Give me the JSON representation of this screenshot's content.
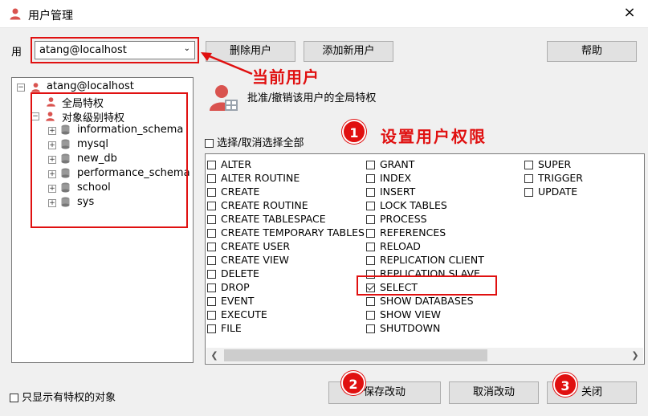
{
  "window": {
    "title": "用户管理",
    "close_label": "×"
  },
  "user_row": {
    "label": "用",
    "current_user": "atang@localhost",
    "delete_label": "删除用户",
    "add_label": "添加新用户",
    "help_label": "帮助"
  },
  "tree": {
    "root": "atang@localhost",
    "global": "全局特权",
    "object": "对象级别特权",
    "databases": [
      "information_schema",
      "mysql",
      "new_db",
      "performance_schema",
      "school",
      "sys"
    ]
  },
  "privileges_header": {
    "description": "批准/撤销该用户的全局特权",
    "select_all": "选择/取消选择全部"
  },
  "privileges": {
    "col1": [
      {
        "label": "ALTER",
        "checked": false
      },
      {
        "label": "ALTER ROUTINE",
        "checked": false
      },
      {
        "label": "CREATE",
        "checked": false
      },
      {
        "label": "CREATE ROUTINE",
        "checked": false
      },
      {
        "label": "CREATE TABLESPACE",
        "checked": false
      },
      {
        "label": "CREATE TEMPORARY TABLES",
        "checked": false
      },
      {
        "label": "CREATE USER",
        "checked": false
      },
      {
        "label": "CREATE VIEW",
        "checked": false
      },
      {
        "label": "DELETE",
        "checked": false
      },
      {
        "label": "DROP",
        "checked": false
      },
      {
        "label": "EVENT",
        "checked": false
      },
      {
        "label": "EXECUTE",
        "checked": false
      },
      {
        "label": "FILE",
        "checked": false
      }
    ],
    "col2": [
      {
        "label": "GRANT",
        "checked": false
      },
      {
        "label": "INDEX",
        "checked": false
      },
      {
        "label": "INSERT",
        "checked": false
      },
      {
        "label": "LOCK TABLES",
        "checked": false
      },
      {
        "label": "PROCESS",
        "checked": false
      },
      {
        "label": "REFERENCES",
        "checked": false
      },
      {
        "label": "RELOAD",
        "checked": false
      },
      {
        "label": "REPLICATION CLIENT",
        "checked": false
      },
      {
        "label": "REPLICATION SLAVE",
        "checked": false
      },
      {
        "label": "SELECT",
        "checked": true
      },
      {
        "label": "SHOW DATABASES",
        "checked": false
      },
      {
        "label": "SHOW VIEW",
        "checked": false
      },
      {
        "label": "SHUTDOWN",
        "checked": false
      }
    ],
    "col3": [
      {
        "label": "SUPER",
        "checked": false
      },
      {
        "label": "TRIGGER",
        "checked": false
      },
      {
        "label": "UPDATE",
        "checked": false
      }
    ]
  },
  "annotations": {
    "current_user": "当前用户",
    "set_privileges": "设置用户权限",
    "badge1": "1",
    "badge2": "2",
    "badge3": "3"
  },
  "bottom": {
    "only_priv": "只显示有特权的对象",
    "save_label": "保存改动",
    "cancel_label": "取消改动",
    "close_label": "关闭"
  },
  "colors": {
    "accent_red": "#e01010",
    "user_icon": "#d9534f"
  }
}
